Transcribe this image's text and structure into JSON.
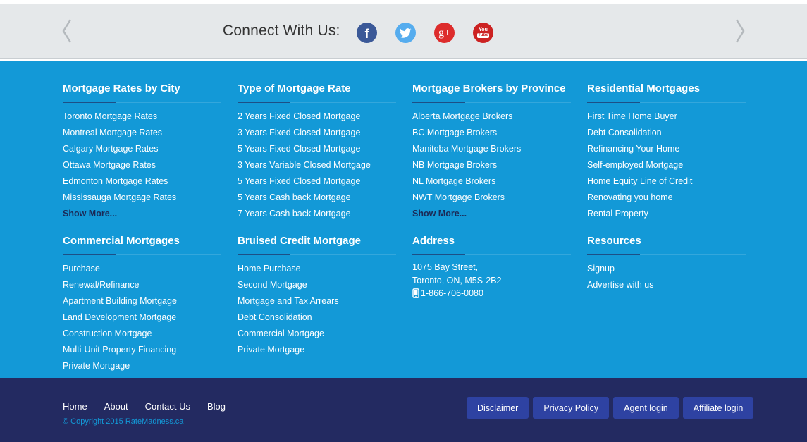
{
  "connect": {
    "title": "Connect With Us:",
    "social": [
      {
        "name": "facebook-icon",
        "glyph": "f",
        "color": "#3b5998"
      },
      {
        "name": "twitter-icon",
        "color": "#55acee"
      },
      {
        "name": "google-plus-icon",
        "glyph": "g+",
        "color": "#dd2c2c"
      },
      {
        "name": "youtube-icon",
        "glyph_top": "You",
        "glyph_bottom": "Tube",
        "color": "#cc2222"
      }
    ]
  },
  "columns": {
    "rates_by_city": {
      "title": "Mortgage Rates by City",
      "items": [
        "Toronto Mortgage Rates",
        "Montreal Mortgage Rates",
        "Calgary Mortgage Rates",
        "Ottawa Mortgage Rates",
        "Edmonton Mortgage Rates",
        "Mississauga Mortgage Rates"
      ],
      "more": "Show More..."
    },
    "rate_type": {
      "title": "Type of Mortgage Rate",
      "items": [
        "2 Years Fixed Closed Mortgage",
        "3 Years Fixed Closed Mortgage",
        "5 Years Fixed Closed Mortgage",
        "3 Years Variable Closed Mortgage",
        "5 Years Fixed Closed Mortgage",
        "5 Years Cash back Mortgage",
        "7 Years Cash back Mortgage"
      ]
    },
    "brokers_by_province": {
      "title": "Mortgage Brokers by Province",
      "items": [
        "Alberta Mortgage Brokers",
        "BC Mortgage Brokers",
        "Manitoba Mortgage Brokers",
        "NB Mortgage Brokers",
        "NL Mortgage Brokers",
        "NWT Mortgage Brokers"
      ],
      "more": "Show More..."
    },
    "residential": {
      "title": "Residential Mortgages",
      "items": [
        "First Time Home Buyer",
        "Debt Consolidation",
        "Refinancing Your Home",
        "Self-employed Mortgage",
        "Home Equity Line of Credit",
        "Renovating you home",
        "Rental Property"
      ]
    },
    "commercial": {
      "title": "Commercial Mortgages",
      "items": [
        "Purchase",
        "Renewal/Refinance",
        "Apartment Building Mortgage",
        "Land Development Mortgage",
        "Construction Mortgage",
        "Multi-Unit Property Financing",
        "Private Mortgage"
      ]
    },
    "bruised_credit": {
      "title": "Bruised Credit Mortgage",
      "items": [
        "Home Purchase",
        "Second Mortgage",
        "Mortgage and Tax Arrears",
        "Debt Consolidation",
        "Commercial Mortgage",
        "Private Mortgage"
      ]
    },
    "address": {
      "title": "Address",
      "line1": "1075 Bay Street,",
      "line2": "Toronto, ON, M5S-2B2",
      "phone": "1-866-706-0080"
    },
    "resources": {
      "title": "Resources",
      "items": [
        "Signup",
        "Advertise with us"
      ]
    }
  },
  "footer": {
    "nav": [
      "Home",
      "About",
      "Contact Us",
      "Blog"
    ],
    "copyright": "© Copyright 2015 RateMadness.ca",
    "buttons": [
      "Disclaimer",
      "Privacy Policy",
      "Agent login",
      "Affiliate login"
    ]
  },
  "colors": {
    "connect_bar": "#e5e8ea",
    "main_blue": "#1399d7",
    "dark_navy": "#232a61",
    "button": "#2e42a2",
    "show_more": "#1b2a57"
  }
}
